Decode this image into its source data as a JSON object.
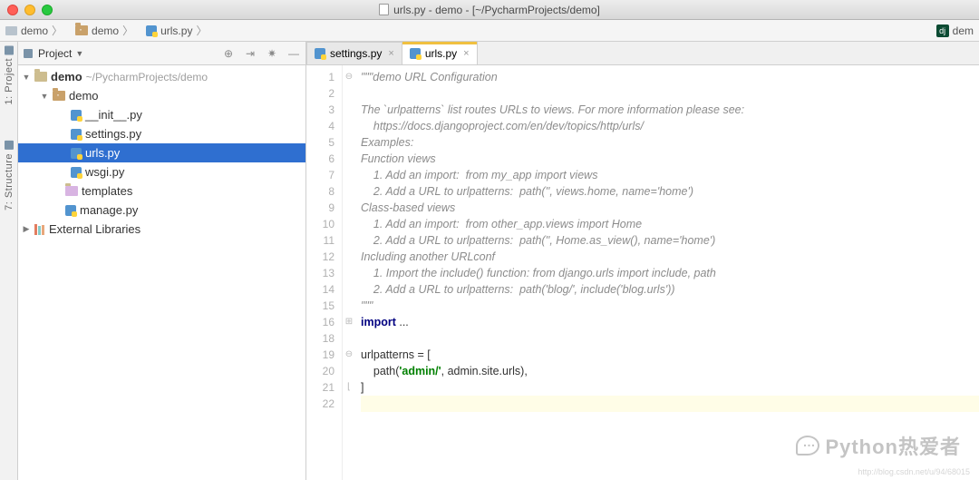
{
  "window": {
    "title": "urls.py - demo - [~/PycharmProjects/demo]"
  },
  "breadcrumbs": [
    {
      "label": "demo",
      "icon": "folder"
    },
    {
      "label": "demo",
      "icon": "package"
    },
    {
      "label": "urls.py",
      "icon": "python"
    }
  ],
  "nav_right": {
    "framework": "dj",
    "label": "dem"
  },
  "tool_rail": {
    "project": "1: Project",
    "structure": "7: Structure"
  },
  "project_panel": {
    "title": "Project",
    "root": {
      "name": "demo",
      "path": "~/PycharmProjects/demo"
    },
    "pkg": {
      "name": "demo"
    },
    "files": [
      "__init__.py",
      "settings.py",
      "urls.py",
      "wsgi.py"
    ],
    "templates": "templates",
    "manage": "manage.py",
    "ext_libs": "External Libraries"
  },
  "tabs": [
    {
      "label": "settings.py",
      "active": false
    },
    {
      "label": "urls.py",
      "active": true
    }
  ],
  "editor": {
    "lines": [
      1,
      2,
      3,
      4,
      5,
      6,
      7,
      8,
      9,
      10,
      11,
      12,
      13,
      14,
      15,
      16,
      18,
      19,
      20,
      21,
      22
    ],
    "docstring": [
      "\"\"\"demo URL Configuration",
      "",
      "The `urlpatterns` list routes URLs to views. For more information please see:",
      "    https://docs.djangoproject.com/en/dev/topics/http/urls/",
      "Examples:",
      "Function views",
      "    1. Add an import:  from my_app import views",
      "    2. Add a URL to urlpatterns:  path('', views.home, name='home')",
      "Class-based views",
      "    1. Add an import:  from other_app.views import Home",
      "    2. Add a URL to urlpatterns:  path('', Home.as_view(), name='home')",
      "Including another URLconf",
      "    1. Import the include() function: from django.urls import include, path",
      "    2. Add a URL to urlpatterns:  path('blog/', include('blog.urls'))",
      "\"\"\""
    ],
    "import_line": {
      "kw": "import",
      "rest": " ..."
    },
    "code_tail": {
      "l19": "urlpatterns = [",
      "l20_pre": "    path(",
      "l20_str": "'admin/'",
      "l20_post": ", admin.site.urls),",
      "l21": "]"
    }
  },
  "watermark": "Python热爱者",
  "footer_url": "http://blog.csdn.net/u/94/68015"
}
